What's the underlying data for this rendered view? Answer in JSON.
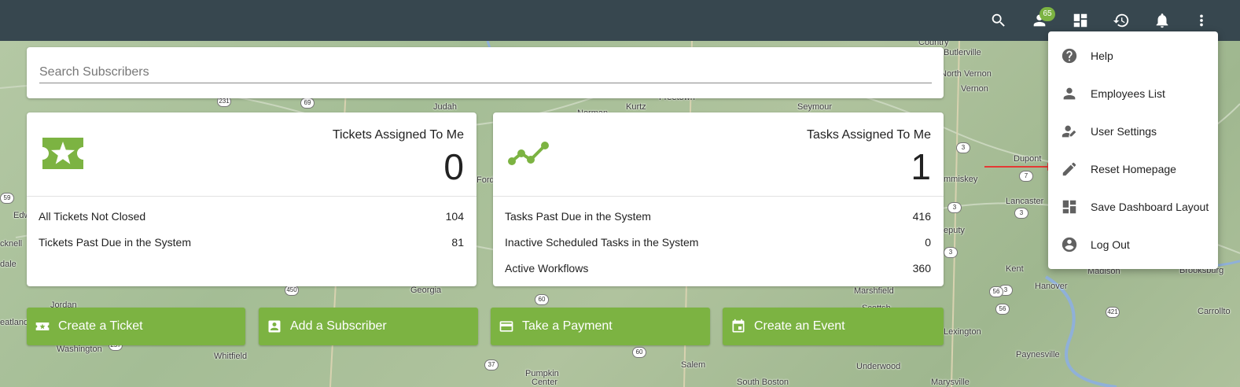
{
  "topbar": {
    "icons": [
      "search-icon",
      "person-icon",
      "dashboard-icon",
      "history-icon",
      "bell-icon",
      "more-vert-icon"
    ],
    "employee_badge": "65"
  },
  "search": {
    "placeholder": "Search Subscribers"
  },
  "tickets_card": {
    "icon": "ticket-star-icon",
    "title": "Tickets Assigned To Me",
    "value": "0",
    "rows": [
      {
        "label": "All Tickets Not Closed",
        "value": "104"
      },
      {
        "label": "Tickets Past Due in the System",
        "value": "81"
      }
    ]
  },
  "tasks_card": {
    "icon": "timeline-icon",
    "title": "Tasks Assigned To Me",
    "value": "1",
    "rows": [
      {
        "label": "Tasks Past Due in the System",
        "value": "416"
      },
      {
        "label": "Inactive Scheduled Tasks in the System",
        "value": "0"
      },
      {
        "label": "Active Workflows",
        "value": "360"
      }
    ]
  },
  "actions": [
    {
      "label": "Create a Ticket",
      "icon": "ticket-icon"
    },
    {
      "label": "Add a Subscriber",
      "icon": "contact-icon"
    },
    {
      "label": "Take a Payment",
      "icon": "credit-card-icon"
    },
    {
      "label": "Create an Event",
      "icon": "event-icon"
    }
  ],
  "menu": {
    "items": [
      {
        "label": "Help",
        "icon": "help-icon"
      },
      {
        "label": "Employees List",
        "icon": "person-icon"
      },
      {
        "label": "User Settings",
        "icon": "user-edit-icon"
      },
      {
        "label": "Reset Homepage",
        "icon": "pencil-icon"
      },
      {
        "label": "Save Dashboard Layout",
        "icon": "dashboard-icon"
      },
      {
        "label": "Log Out",
        "icon": "account-circle-icon"
      }
    ]
  },
  "map": {
    "labels": [
      "Country",
      "Butlerville",
      "North Vernon",
      "Vernon",
      "Judah",
      "Kurtz",
      "Freetown",
      "Seymour",
      "Dupont",
      "mmiskey",
      "Lancaster",
      "Kent",
      "Madison",
      "Brooksburg",
      "Hanover",
      "Carrollto",
      "Georgia",
      "Marshfield",
      "Jordan",
      "Washington",
      "Whitfield",
      "Salem",
      "Lexington",
      "Paynesville",
      "Underwood",
      "Pumpkin",
      "Center",
      "South Boston",
      "Marysville",
      "Edw",
      "cknell",
      "dale",
      "eatland",
      "Norman",
      "Ford",
      "eputy",
      "Scottsb"
    ],
    "shields": [
      "231",
      "69",
      "3",
      "3",
      "7",
      "3",
      "3",
      "3",
      "450",
      "60",
      "56",
      "421",
      "257",
      "60",
      "37",
      "56",
      "59"
    ]
  },
  "colors": {
    "topbar": "#37474f",
    "accent": "#7cb342",
    "badge": "#7cb342",
    "arrow": "#e53935"
  }
}
